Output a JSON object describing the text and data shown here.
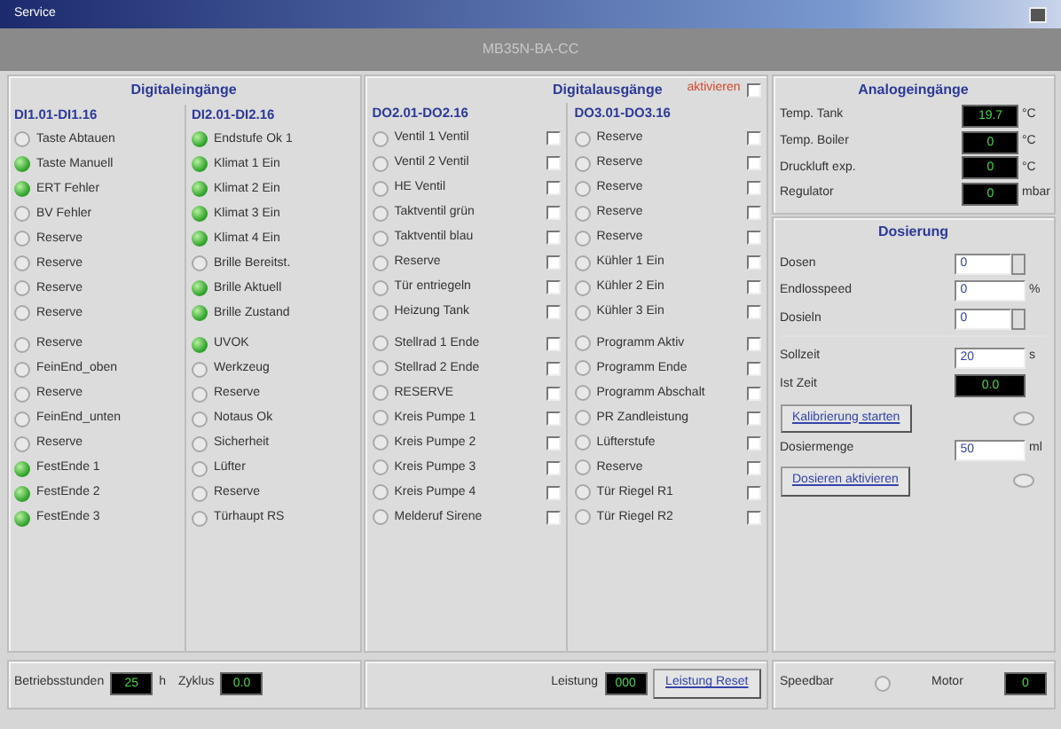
{
  "window": {
    "title": "Service"
  },
  "header": "MB35N-BA-CC",
  "inputs": {
    "title": "Digitaleingänge",
    "columns": [
      {
        "title": "DI1.01-DI1.16",
        "items": [
          {
            "label": "Taste Abtauen",
            "on": false
          },
          {
            "label": "Taste Manuell",
            "on": true
          },
          {
            "label": "ERT Fehler",
            "on": true
          },
          {
            "label": "BV Fehler",
            "on": false
          },
          {
            "label": "Reserve",
            "on": false
          },
          {
            "label": "Reserve",
            "on": false
          },
          {
            "label": "Reserve",
            "on": false
          },
          {
            "label": "Reserve",
            "on": false
          },
          {
            "label": "Reserve",
            "on": false
          },
          {
            "label": "FeinEnd_oben",
            "on": false
          },
          {
            "label": "Reserve",
            "on": false
          },
          {
            "label": "FeinEnd_unten",
            "on": false
          },
          {
            "label": "Reserve",
            "on": false
          },
          {
            "label": "FestEnde 1",
            "on": true
          },
          {
            "label": "FestEnde 2",
            "on": true
          },
          {
            "label": "FestEnde 3",
            "on": true
          }
        ]
      },
      {
        "title": "DI2.01-DI2.16",
        "items": [
          {
            "label": "Endstufe Ok 1",
            "on": true
          },
          {
            "label": "Klimat 1 Ein",
            "on": true
          },
          {
            "label": "Klimat 2 Ein",
            "on": true
          },
          {
            "label": "Klimat 3 Ein",
            "on": true
          },
          {
            "label": "Klimat 4 Ein",
            "on": true
          },
          {
            "label": "Brille Bereitst.",
            "on": false
          },
          {
            "label": "Brille Aktuell",
            "on": true
          },
          {
            "label": "Brille Zustand",
            "on": true
          },
          {
            "label": "UVOK",
            "on": true
          },
          {
            "label": "Werkzeug",
            "on": false
          },
          {
            "label": "Reserve",
            "on": false
          },
          {
            "label": "Notaus Ok",
            "on": false
          },
          {
            "label": "Sicherheit",
            "on": false
          },
          {
            "label": "Lüfter",
            "on": false
          },
          {
            "label": "Reserve",
            "on": false
          },
          {
            "label": "Türhaupt RS",
            "on": false
          }
        ]
      }
    ]
  },
  "outputs": {
    "title": "Digitalausgänge",
    "activate_label": "aktivieren",
    "activate_checked": false,
    "columns": [
      {
        "title": "DO2.01-DO2.16",
        "items": [
          {
            "label": "Ventil 1 Ventil",
            "on": false,
            "checked": false
          },
          {
            "label": "Ventil 2 Ventil",
            "on": false,
            "checked": false
          },
          {
            "label": "HE Ventil",
            "on": false,
            "checked": false
          },
          {
            "label": "Taktventil grün",
            "on": false,
            "checked": false
          },
          {
            "label": "Taktventil blau",
            "on": false,
            "checked": false
          },
          {
            "label": "Reserve",
            "on": false,
            "checked": false
          },
          {
            "label": "Tür entriegeln",
            "on": false,
            "checked": false
          },
          {
            "label": "Heizung Tank",
            "on": false,
            "checked": false
          },
          {
            "label": "Stellrad 1 Ende",
            "on": false,
            "checked": false
          },
          {
            "label": "Stellrad 2 Ende",
            "on": false,
            "checked": false
          },
          {
            "label": "RESERVE",
            "on": false,
            "checked": false
          },
          {
            "label": "Kreis Pumpe 1",
            "on": false,
            "checked": false
          },
          {
            "label": "Kreis Pumpe 2",
            "on": false,
            "checked": false
          },
          {
            "label": "Kreis Pumpe 3",
            "on": false,
            "checked": false
          },
          {
            "label": "Kreis Pumpe 4",
            "on": false,
            "checked": false
          },
          {
            "label": "Melderuf Sirene",
            "on": false,
            "checked": false
          }
        ]
      },
      {
        "title": "DO3.01-DO3.16",
        "items": [
          {
            "label": "Reserve",
            "on": false,
            "checked": false
          },
          {
            "label": "Reserve",
            "on": false,
            "checked": false
          },
          {
            "label": "Reserve",
            "on": false,
            "checked": false
          },
          {
            "label": "Reserve",
            "on": false,
            "checked": false
          },
          {
            "label": "Reserve",
            "on": false,
            "checked": false
          },
          {
            "label": "Kühler 1 Ein",
            "on": false,
            "checked": false
          },
          {
            "label": "Kühler 2 Ein",
            "on": false,
            "checked": false
          },
          {
            "label": "Kühler 3 Ein",
            "on": false,
            "checked": false
          },
          {
            "label": "Programm Aktiv",
            "on": false,
            "checked": false
          },
          {
            "label": "Programm Ende",
            "on": false,
            "checked": false
          },
          {
            "label": "Programm Abschalt",
            "on": false,
            "checked": false
          },
          {
            "label": "PR Zandleistung",
            "on": false,
            "checked": false
          },
          {
            "label": "Lüfterstufe",
            "on": false,
            "checked": false
          },
          {
            "label": "Reserve",
            "on": false,
            "checked": false
          },
          {
            "label": "Tür Riegel R1",
            "on": false,
            "checked": false
          },
          {
            "label": "Tür Riegel R2",
            "on": false,
            "checked": false
          }
        ]
      }
    ]
  },
  "analog": {
    "title": "Analogeingänge",
    "rows": [
      {
        "label": "Temp. Tank",
        "value": "19.7",
        "unit": "°C"
      },
      {
        "label": "Temp. Boiler",
        "value": "0",
        "unit": "°C"
      },
      {
        "label": "Druckluft exp.",
        "value": "0",
        "unit": "°C"
      },
      {
        "label": "Regulator",
        "value": "0",
        "unit": "mbar"
      }
    ]
  },
  "dosing": {
    "title": "Dosierung",
    "groups": [
      [
        {
          "kind": "spin",
          "label": "Dosen",
          "value": "0"
        },
        {
          "kind": "text",
          "label": "Endlosspeed",
          "value": "0",
          "unit": "%"
        },
        {
          "kind": "spin",
          "label": "Dosieln",
          "value": "0"
        }
      ],
      [
        {
          "kind": "text",
          "label": "Sollzeit",
          "value": "20",
          "unit": "s"
        },
        {
          "kind": "display",
          "label": "Ist Zeit",
          "value": "0.0"
        },
        {
          "kind": "button",
          "label": "Kalibrierung starten",
          "on": false
        },
        {
          "kind": "text",
          "label": "Dosiermenge",
          "value": "50",
          "unit": "ml"
        },
        {
          "kind": "button",
          "label": "Dosieren aktivieren",
          "on": false
        }
      ]
    ]
  },
  "status_bar": [
    [
      {
        "kind": "display",
        "label": "Betriebsstunden",
        "value": "25",
        "unit": "h"
      },
      {
        "kind": "display",
        "label": "Zyklus",
        "value": "0.0"
      }
    ],
    [
      {
        "kind": "display",
        "label": "Leistung",
        "value": "000"
      },
      {
        "kind": "button",
        "label": "Leistung Reset"
      }
    ],
    [
      {
        "kind": "radio",
        "label": "Speedbar",
        "selected": false
      },
      {
        "kind": "display",
        "label": "Motor",
        "value": "0"
      }
    ]
  ]
}
